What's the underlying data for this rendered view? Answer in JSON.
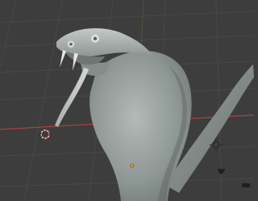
{
  "viewport": {
    "editor": "3D Viewport",
    "background_color": "#3d3d3d",
    "grid_line_color": "#4a4a4a",
    "x_axis_color": "#b0413e",
    "y_axis_color": "#7a9a3a"
  },
  "scene": {
    "object": "cobra-mesh",
    "shading": "solid",
    "mesh_color": "#9aa39f"
  },
  "widgets": {
    "cursor_icon": "3d-cursor-icon",
    "origin_icon": "object-origin-icon",
    "light_icon": "sun-light-icon",
    "camera_icon": "camera-icon"
  }
}
